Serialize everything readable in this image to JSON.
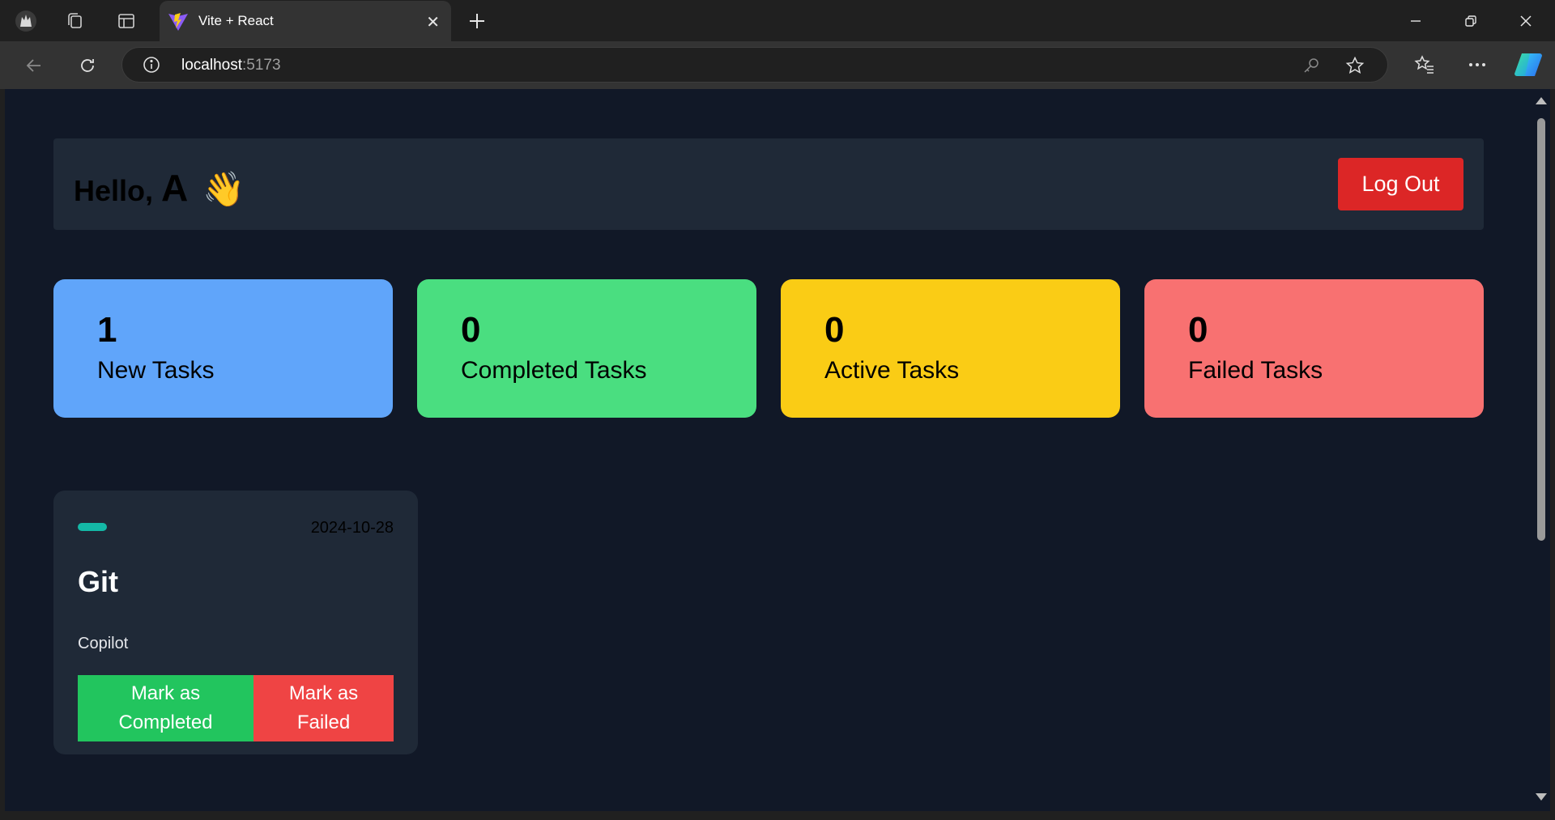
{
  "browser": {
    "tab_title": "Vite + React",
    "url_host": "localhost",
    "url_port": ":5173",
    "icons": [
      "profile-icon",
      "collections-icon",
      "vertical-tabs-icon",
      "vite-favicon",
      "close-tab-icon",
      "new-tab-icon",
      "minimize-icon",
      "restore-icon",
      "close-window-icon",
      "back-icon",
      "refresh-icon",
      "site-info-icon",
      "password-key-icon",
      "favorite-star-icon",
      "favorites-icon",
      "more-icon",
      "copilot-icon"
    ]
  },
  "header": {
    "greeting": "Hello,",
    "name": "A",
    "wave_emoji": "👋",
    "logout_label": "Log Out"
  },
  "stats": [
    {
      "count": "1",
      "label": "New Tasks",
      "color": "#60a5fa"
    },
    {
      "count": "0",
      "label": "Completed Tasks",
      "color": "#4ade80"
    },
    {
      "count": "0",
      "label": "Active Tasks",
      "color": "#facc15"
    },
    {
      "count": "0",
      "label": "Failed Tasks",
      "color": "#f87171"
    }
  ],
  "task": {
    "category_color": "#14b8a6",
    "date": "2024-10-28",
    "title": "Git",
    "description": "Copilot",
    "complete_label": "Mark as Completed",
    "complete_color": "#22c55e",
    "fail_label": "Mark as Failed",
    "fail_color": "#ef4444"
  },
  "colors": {
    "page_bg": "#111827",
    "panel_bg": "#1f2937",
    "logout": "#dc2626"
  }
}
